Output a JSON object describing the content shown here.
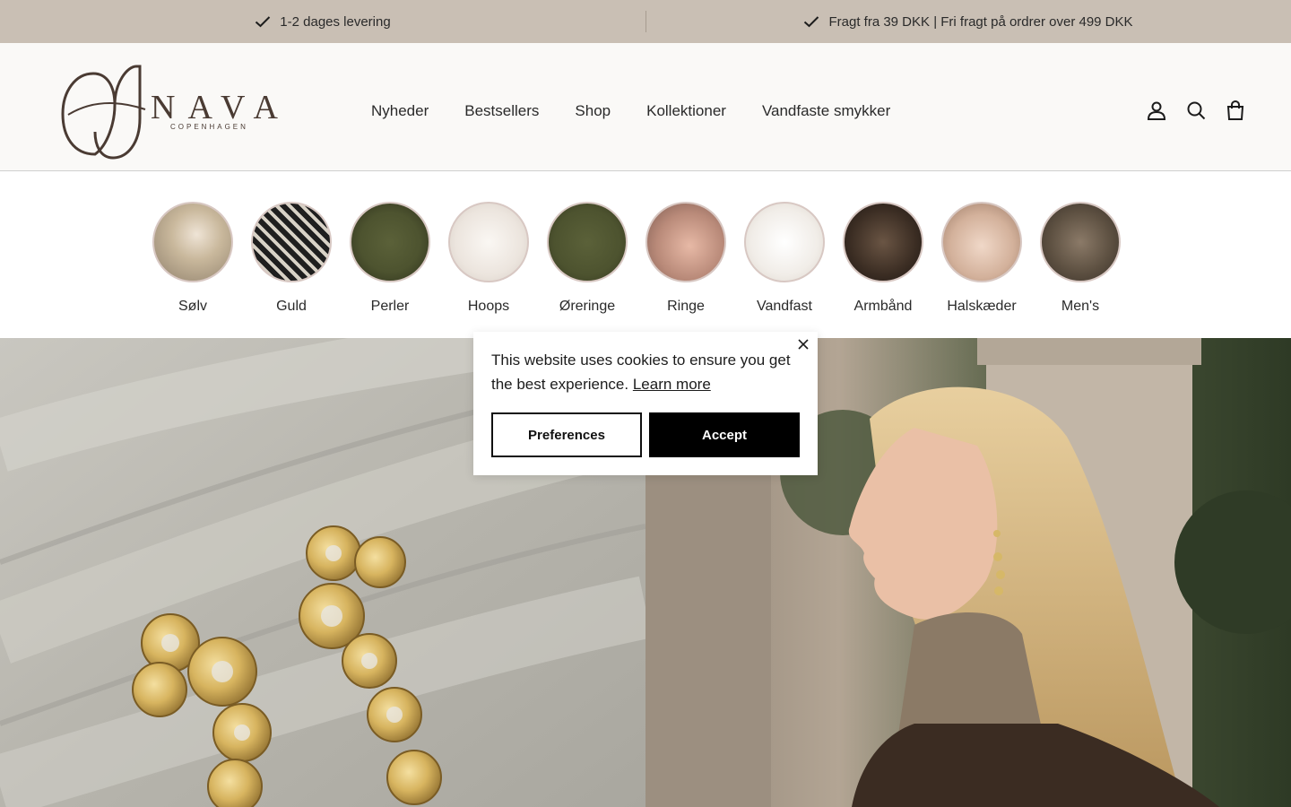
{
  "announcement": {
    "items": [
      {
        "text": "1-2 dages levering",
        "icon": "check-icon"
      },
      {
        "text": "Fragt fra 39 DKK | Fri fragt på ordrer over 499 DKK",
        "icon": "check-icon"
      }
    ]
  },
  "header": {
    "logo": {
      "name": "NAVA",
      "sub": "COPENHAGEN"
    },
    "nav": [
      "Nyheder",
      "Bestsellers",
      "Shop",
      "Kollektioner",
      "Vandfaste smykker"
    ],
    "icons": [
      "account-icon",
      "search-icon",
      "cart-icon"
    ]
  },
  "categories": [
    {
      "label": "Sølv"
    },
    {
      "label": "Guld"
    },
    {
      "label": "Perler"
    },
    {
      "label": "Hoops"
    },
    {
      "label": "Øreringe"
    },
    {
      "label": "Ringe"
    },
    {
      "label": "Vandfast"
    },
    {
      "label": "Armbånd"
    },
    {
      "label": "Halskæder"
    },
    {
      "label": "Men's"
    }
  ],
  "cookie": {
    "message": "This website uses cookies to ensure you get the best experience.",
    "learn_more": "Learn more",
    "preferences": "Preferences",
    "accept": "Accept"
  },
  "colors": {
    "announcement_bg": "#c9bfb4",
    "header_bg": "#faf9f7",
    "accent": "#000000",
    "logo": "#4a3b33"
  }
}
